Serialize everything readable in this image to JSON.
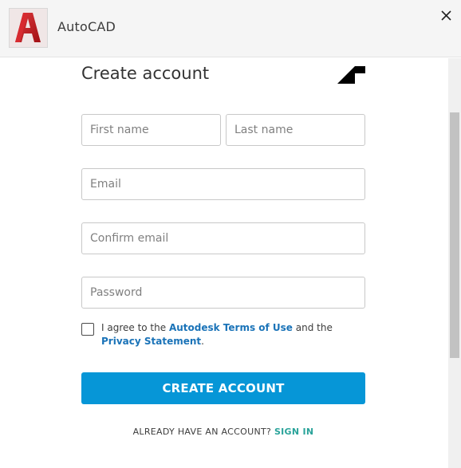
{
  "window": {
    "app_icon": "autocad-logo-icon",
    "app_title": "AutoCAD",
    "close_icon": "close-icon"
  },
  "form": {
    "title": "Create account",
    "logo_icon": "autodesk-logo-icon",
    "first_name": {
      "value": "",
      "placeholder": "First name"
    },
    "last_name": {
      "value": "",
      "placeholder": "Last name"
    },
    "email": {
      "value": "",
      "placeholder": "Email"
    },
    "confirm_email": {
      "value": "",
      "placeholder": "Confirm email"
    },
    "password": {
      "value": "",
      "placeholder": "Password"
    },
    "terms": {
      "checked": false,
      "prefix": "I agree to the ",
      "terms_link": "Autodesk Terms of Use",
      "middle": " and the ",
      "privacy_link": "Privacy Statement",
      "suffix": "."
    },
    "submit_label": "CREATE ACCOUNT",
    "signin_prompt": "ALREADY HAVE AN ACCOUNT?",
    "signin_link": "SIGN IN"
  },
  "colors": {
    "primary_button": "#0696d7",
    "link": "#1a73b8",
    "signin_link": "#2aa39a",
    "app_icon_red": "#c4161c"
  }
}
